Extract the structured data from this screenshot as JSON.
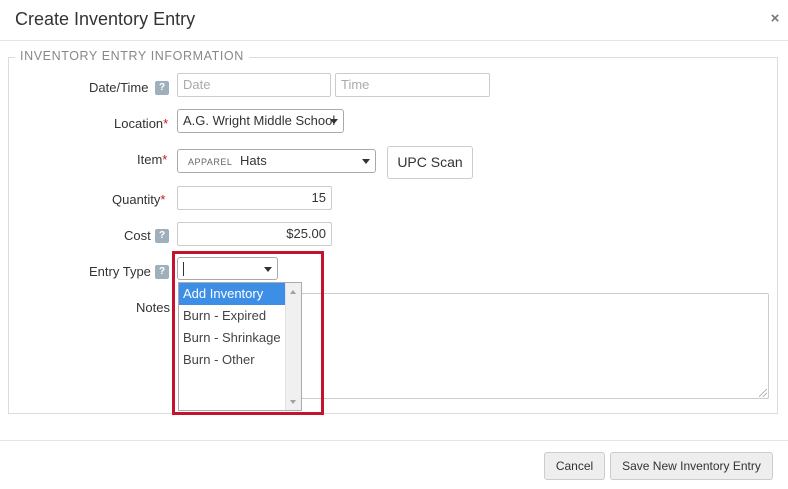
{
  "modal": {
    "title": "Create Inventory Entry",
    "close_glyph": "×",
    "close_icon": "close-icon"
  },
  "section": {
    "legend": "INVENTORY ENTRY INFORMATION"
  },
  "fields": {
    "datetime": {
      "label": "Date/Time",
      "help": "?",
      "date_placeholder": "Date",
      "time_placeholder": "Time"
    },
    "location": {
      "label": "Location",
      "required_mark": "*",
      "value": "A.G. Wright Middle School"
    },
    "item": {
      "label": "Item",
      "required_mark": "*",
      "category_tag": "APPAREL",
      "value": "Hats",
      "upc_button": "UPC Scan"
    },
    "quantity": {
      "label": "Quantity",
      "required_mark": "*",
      "value": "15"
    },
    "cost": {
      "label": "Cost",
      "help": "?",
      "value": "$25.00"
    },
    "entry_type": {
      "label": "Entry Type",
      "help": "?",
      "value": "",
      "options": [
        "Add Inventory",
        "Burn - Expired",
        "Burn - Shrinkage",
        "Burn - Other"
      ],
      "highlighted_option": "Add Inventory"
    },
    "notes": {
      "label": "Notes",
      "value": ""
    }
  },
  "footer": {
    "cancel": "Cancel",
    "save": "Save New Inventory Entry"
  },
  "colors": {
    "highlight_border": "#c4122f",
    "selected_option_bg": "#3d8ee6",
    "required": "#c4161c"
  }
}
